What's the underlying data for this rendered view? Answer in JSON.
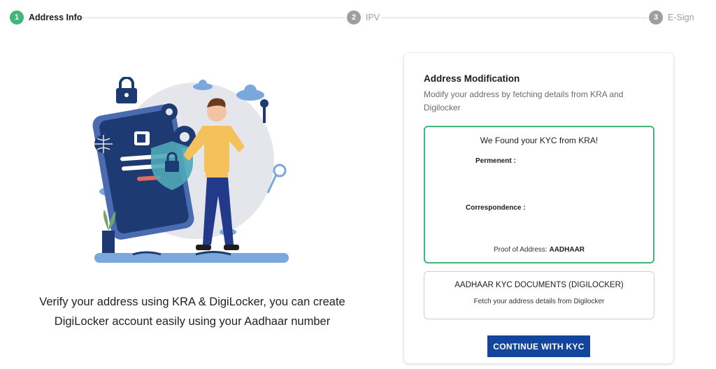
{
  "stepper": {
    "steps": [
      {
        "number": "1",
        "label": "Address Info",
        "color": "#43b57a",
        "active": true
      },
      {
        "number": "2",
        "label": "IPV",
        "color": "#9e9e9e",
        "active": false
      },
      {
        "number": "3",
        "label": "E-Sign",
        "color": "#9e9e9e",
        "active": false
      }
    ]
  },
  "left": {
    "description_line1": "Verify your address using KRA & DigiLocker, you can create",
    "description_line2": "DigiLocker account easily using your Aadhaar number"
  },
  "card": {
    "title": "Address Modification",
    "subtitle": "Modify your address by fetching details from KRA and Digilocker",
    "kra": {
      "title": "We Found your KYC from KRA!",
      "permanent_label": "Permenent :",
      "permanent_value": "",
      "correspondence_label": "Correspondence :",
      "correspondence_value": "",
      "proof_label": "Proof of Address:",
      "proof_value": "AADHAAR",
      "border_color": "#43b57a"
    },
    "digilocker": {
      "title": "AADHAAR KYC DOCUMENTS (DIGILOCKER)",
      "subtitle": "Fetch your address details from Digilocker"
    },
    "continue_label": "CONTINUE WITH KYC",
    "accent_color": "#14459d"
  }
}
